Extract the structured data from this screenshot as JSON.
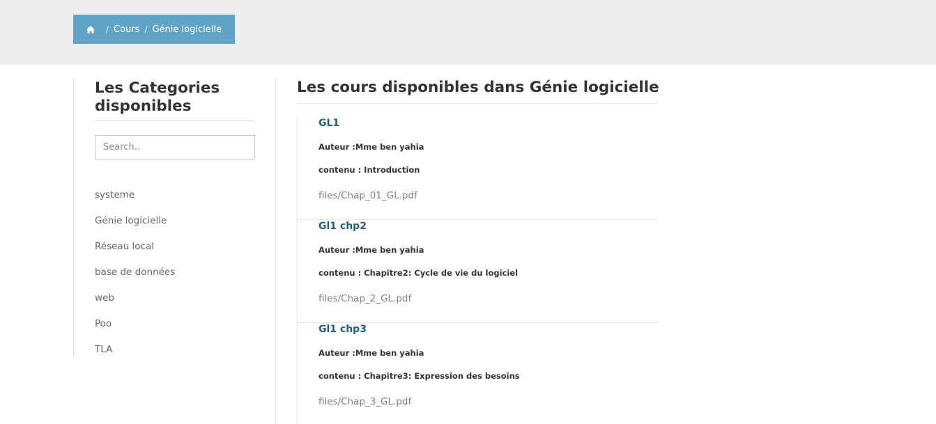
{
  "breadcrumb": {
    "home_icon": "home-icon",
    "separator": "/",
    "items": [
      {
        "label": "Cours"
      },
      {
        "label": "Génie logicielle"
      }
    ]
  },
  "sidebar": {
    "title": "Les Categories disponibles",
    "search": {
      "placeholder": "Search..",
      "value": ""
    },
    "categories": [
      {
        "label": "systeme"
      },
      {
        "label": "Génie logicielle"
      },
      {
        "label": "Réseau local"
      },
      {
        "label": "base de données"
      },
      {
        "label": "web"
      },
      {
        "label": "Poo"
      },
      {
        "label": "TLA"
      }
    ]
  },
  "main": {
    "title": "Les cours disponibles dans Génie logicielle",
    "courses": [
      {
        "title": "GL1",
        "author": "Auteur :Mme ben yahia",
        "content": "contenu : Introduction",
        "file": "files/Chap_01_GL.pdf"
      },
      {
        "title": "Gl1 chp2",
        "author": "Auteur :Mme ben yahia",
        "content": "contenu : Chapitre2: Cycle de vie du logiciel",
        "file": "files/Chap_2_GL.pdf"
      },
      {
        "title": "Gl1 chp3",
        "author": "Auteur :Mme ben yahia",
        "content": "contenu : Chapitre3: Expression des besoins",
        "file": "files/Chap_3_GL.pdf"
      }
    ]
  },
  "colors": {
    "header_band": "#eeeeee",
    "breadcrumb_bg": "#5fa3c6",
    "course_title": "#1e5f87"
  }
}
